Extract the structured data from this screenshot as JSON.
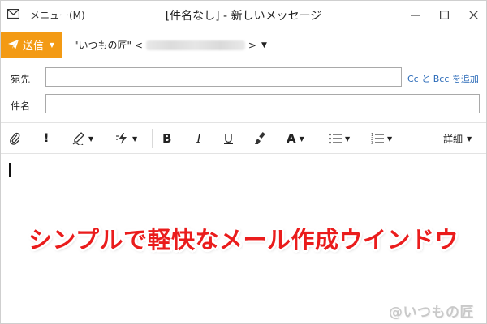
{
  "titlebar": {
    "icon": "mail-icon",
    "menu_label": "メニュー(M)",
    "title": "[件名なし] - 新しいメッセージ",
    "minimize": "—",
    "maximize": "☐",
    "close": "✕"
  },
  "send": {
    "label": "送信",
    "icon": "paper-plane-icon",
    "color": "#f39a14"
  },
  "sender": {
    "name": "\"いつもの匠\" <",
    "closing": ">"
  },
  "fields": {
    "to_label": "宛先",
    "to_value": "",
    "cc_link": "Cc と Bcc を追加",
    "subject_label": "件名",
    "subject_value": ""
  },
  "toolbar": {
    "attach_icon": "paperclip-icon",
    "importance": "!",
    "signature_icon": "signature-pen-icon",
    "quick_icon": "lightning-icon",
    "bold": "B",
    "italic": "I",
    "underline": "U",
    "clear_format_icon": "brush-icon",
    "font_color": "A",
    "bullet_list_icon": "bullet-list-icon",
    "numbered_list_icon": "numbered-list-icon",
    "details": "詳細"
  },
  "body": {
    "overlay": "シンプルで軽快なメール作成ウインドウ",
    "overlay_color": "#ea1c1c",
    "watermark": "@いつもの匠"
  }
}
